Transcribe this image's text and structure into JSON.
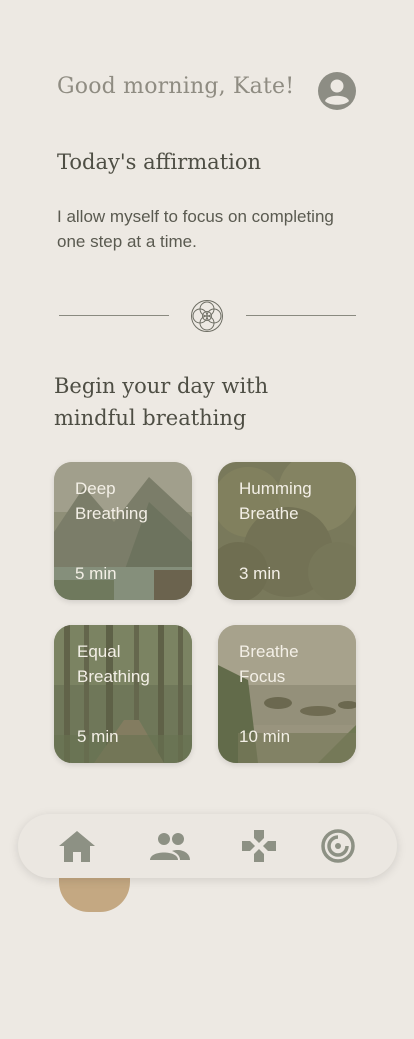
{
  "header": {
    "greeting": "Good morning, Kate!"
  },
  "affirmation": {
    "title": "Today's affirmation",
    "text": "I allow myself to focus on completing one step at a time."
  },
  "section": {
    "title": "Begin your day with mindful breathing"
  },
  "cards": [
    {
      "title": "Deep Breathing",
      "duration": "5 min",
      "image": "mountain-lake"
    },
    {
      "title": "Humming Breathe",
      "duration": "3 min",
      "image": "tree-canopy"
    },
    {
      "title": "Equal Breathing",
      "duration": "5 min",
      "image": "forest-path"
    },
    {
      "title": "Breathe Focus",
      "duration": "10 min",
      "image": "ocean-coast"
    }
  ],
  "nav": {
    "items": [
      "home-icon",
      "community-icon",
      "games-icon",
      "progress-icon"
    ]
  },
  "colors": {
    "background": "#ede9e3",
    "accent": "#c4a882",
    "icon": "#8d9184"
  }
}
